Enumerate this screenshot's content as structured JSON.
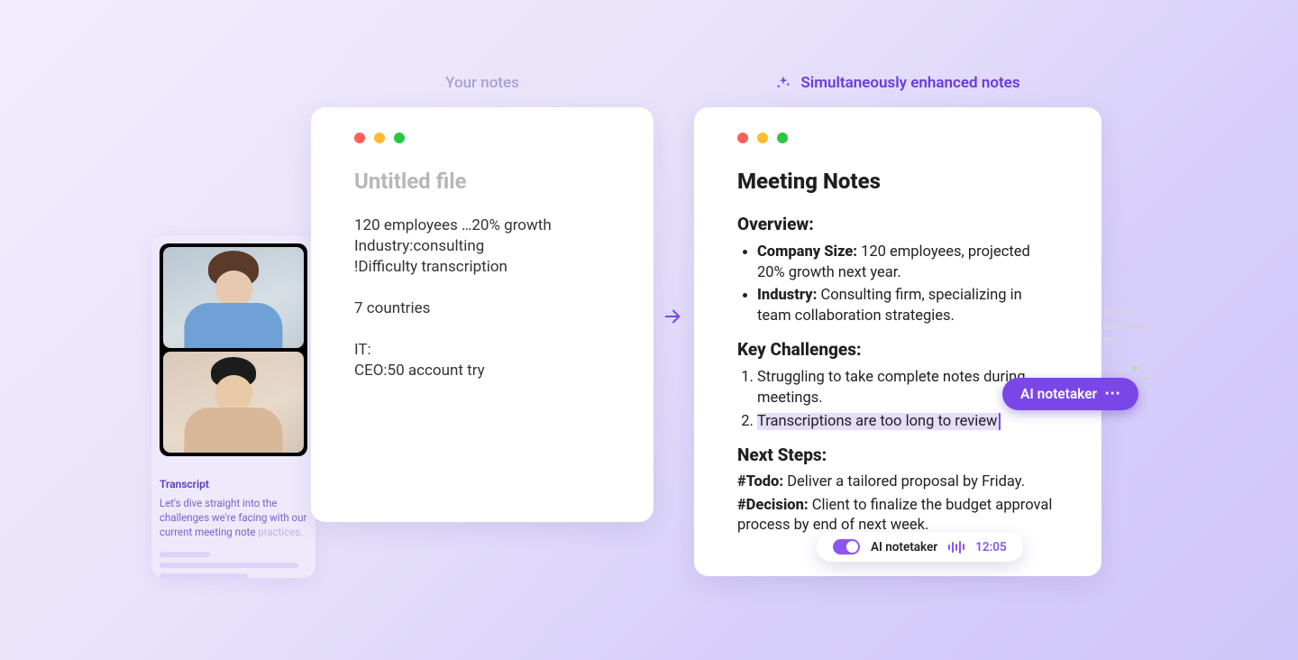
{
  "headings": {
    "left": "Your notes",
    "right": "Simultaneously enhanced notes"
  },
  "transcript": {
    "label": "Transcript",
    "text": "Let's dive straight into the challenges we're facing with our current meeting note ",
    "faded": "practices."
  },
  "left_card": {
    "title": "Untitled file",
    "body": "120 employees …20% growth\nIndustry:consulting\n!Difficulty transcription\n\n7 countries\n\nIT:\nCEO:50 account try"
  },
  "right_card": {
    "title": "Meeting Notes",
    "overview_h": "Overview:",
    "overview": [
      {
        "k": "Company Size:",
        "v": " 120 employees, projected 20% growth next year."
      },
      {
        "k": "Industry:",
        "v": " Consulting firm, specializing in team collaboration strategies."
      }
    ],
    "challenges_h": "Key Challenges:",
    "challenges": [
      "Struggling to take complete notes during meetings.",
      "Transcriptions are too long to review"
    ],
    "next_h": "Next Steps:",
    "steps": [
      {
        "k": "#Todo:",
        "v": " Deliver a tailored proposal by Friday."
      },
      {
        "k": "#Decision:",
        "v": " Client to finalize the budget approval process by end of next week."
      }
    ]
  },
  "ai_tooltip": "AI notetaker",
  "rec_pill": {
    "label": "AI notetaker",
    "time": "12:05"
  }
}
